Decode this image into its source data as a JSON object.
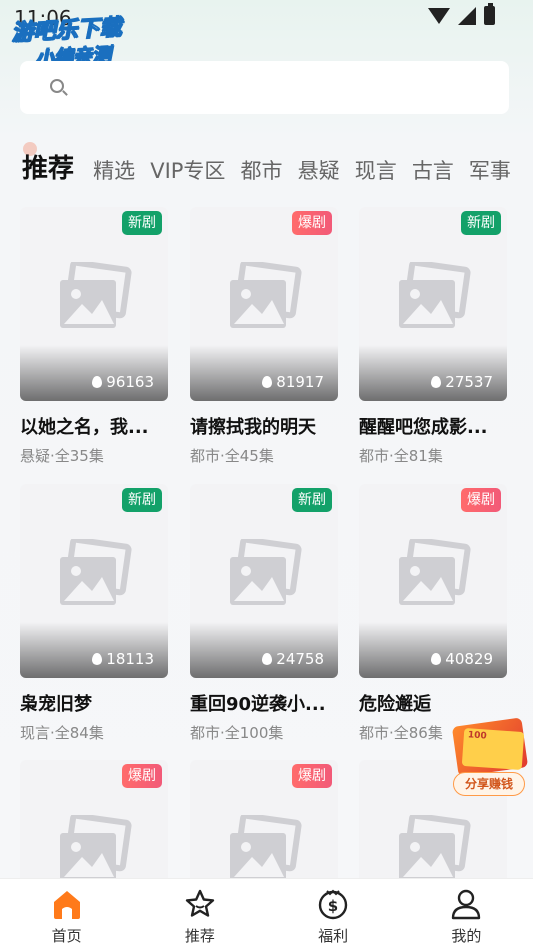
{
  "status": {
    "time": "11:06"
  },
  "watermark": {
    "line1": "游吧乐下载",
    "line2": "小编亲测"
  },
  "search": {
    "placeholder": ""
  },
  "tabs": [
    "推荐",
    "精选",
    "VIP专区",
    "都市",
    "悬疑",
    "现言",
    "古言",
    "军事"
  ],
  "cards": [
    {
      "badge": "新剧",
      "badge_type": "new",
      "views": "96163",
      "title": "以她之名，我...",
      "meta": "悬疑·全35集"
    },
    {
      "badge": "爆剧",
      "badge_type": "hot",
      "views": "81917",
      "title": "请擦拭我的明天",
      "meta": "都市·全45集"
    },
    {
      "badge": "新剧",
      "badge_type": "new",
      "views": "27537",
      "title": "醒醒吧您成影...",
      "meta": "都市·全81集"
    },
    {
      "badge": "新剧",
      "badge_type": "new",
      "views": "18113",
      "title": "枭宠旧梦",
      "meta": "现言·全84集"
    },
    {
      "badge": "新剧",
      "badge_type": "new",
      "views": "24758",
      "title": "重回90逆袭小...",
      "meta": "都市·全100集"
    },
    {
      "badge": "爆剧",
      "badge_type": "hot",
      "views": "40829",
      "title": "危险邂逅",
      "meta": "都市·全86集"
    },
    {
      "badge": "爆剧",
      "badge_type": "hot",
      "views": "",
      "title": "",
      "meta": ""
    },
    {
      "badge": "爆剧",
      "badge_type": "hot",
      "views": "",
      "title": "",
      "meta": ""
    },
    {
      "badge": "",
      "badge_type": "none",
      "views": "",
      "title": "",
      "meta": ""
    }
  ],
  "share": {
    "label": "分享赚钱",
    "amount": "100"
  },
  "bottom_nav": [
    {
      "label": "首页",
      "icon": "home-icon",
      "active": true
    },
    {
      "label": "推荐",
      "icon": "star-icon",
      "active": false
    },
    {
      "label": "福利",
      "icon": "dollar-icon",
      "active": false
    },
    {
      "label": "我的",
      "icon": "user-icon",
      "active": false
    }
  ],
  "colors": {
    "accent": "#ff7a1a",
    "new_badge": "#13a169",
    "hot_badge": "#f25a78"
  }
}
